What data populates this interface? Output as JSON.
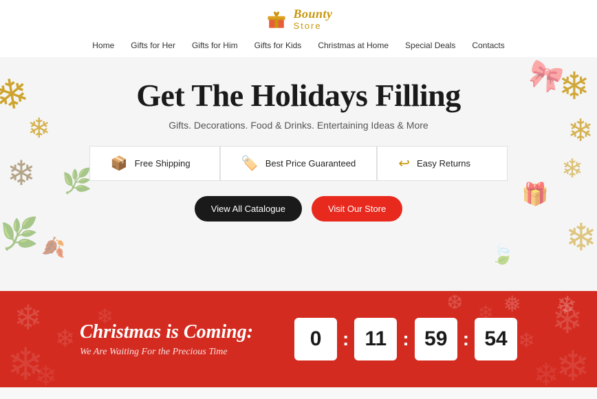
{
  "header": {
    "logo_name": "Bounty",
    "logo_sub": "Store",
    "nav_items": [
      "Home",
      "Gifts for Her",
      "Gifts for Him",
      "Gifts for Kids",
      "Christmas at Home",
      "Special Deals",
      "Contacts"
    ]
  },
  "hero": {
    "title": "Get The Holidays Filling",
    "subtitle": "Gifts. Decorations. Food & Drinks. Entertaining Ideas & More",
    "features": [
      {
        "icon": "📦",
        "label": "Free Shipping"
      },
      {
        "icon": "🏷️",
        "label": "Best Price Guaranteed"
      },
      {
        "icon": "↩️",
        "label": "Easy Returns"
      }
    ],
    "cta_primary": "View All Catalogue",
    "cta_secondary": "Visit Our Store"
  },
  "countdown": {
    "title": "Christmas is Coming:",
    "subtitle": "We Are Waiting For the Precious Time",
    "days": "0",
    "hours": "11",
    "minutes": "59",
    "seconds": "54"
  }
}
